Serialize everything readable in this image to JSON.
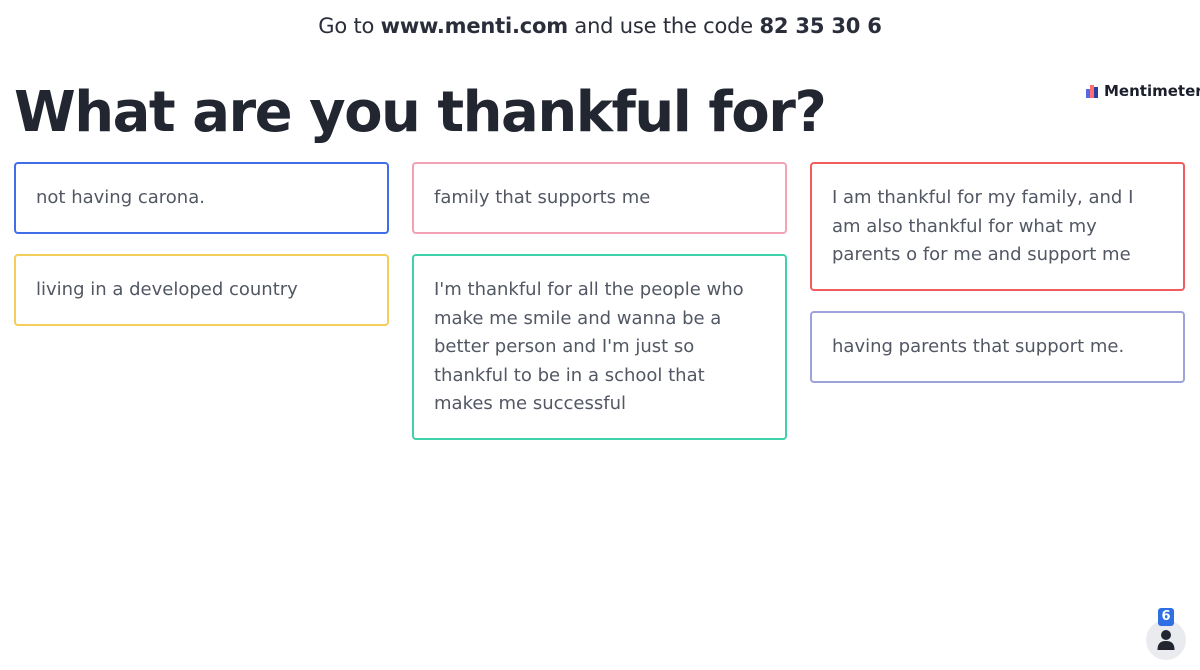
{
  "join": {
    "prefix": "Go to ",
    "url": "www.menti.com",
    "middle": " and use the code ",
    "code": "82 35 30 6"
  },
  "brand": {
    "name": "Mentimeter",
    "icon": "mentimeter-logo-icon",
    "colors": [
      "#5769e7",
      "#ff6e6e",
      "#2b3d9e"
    ]
  },
  "question": {
    "title": "What are you thankful for?"
  },
  "responses": {
    "column_1": [
      {
        "text": "not having carona.",
        "color": "#3f6ee8"
      },
      {
        "text": "living in a developed country",
        "color": "#f5cd5b"
      }
    ],
    "column_2": [
      {
        "text": "family that supports me",
        "color": "#f2a2b4"
      },
      {
        "text": "I'm thankful for all the people who make me smile and wanna be a better person and I'm just so thankful to be in a school that makes me successful",
        "color": "#3dd2aa"
      }
    ],
    "column_3": [
      {
        "text": "I am thankful for my family, and I am also thankful for what my parents o for me and support me",
        "color": "#f25c5c"
      },
      {
        "text": "having parents that support me.",
        "color": "#9ca3db"
      }
    ]
  },
  "participants": {
    "count": "6",
    "icon": "person-icon",
    "badge_color": "#2f6fe4"
  }
}
